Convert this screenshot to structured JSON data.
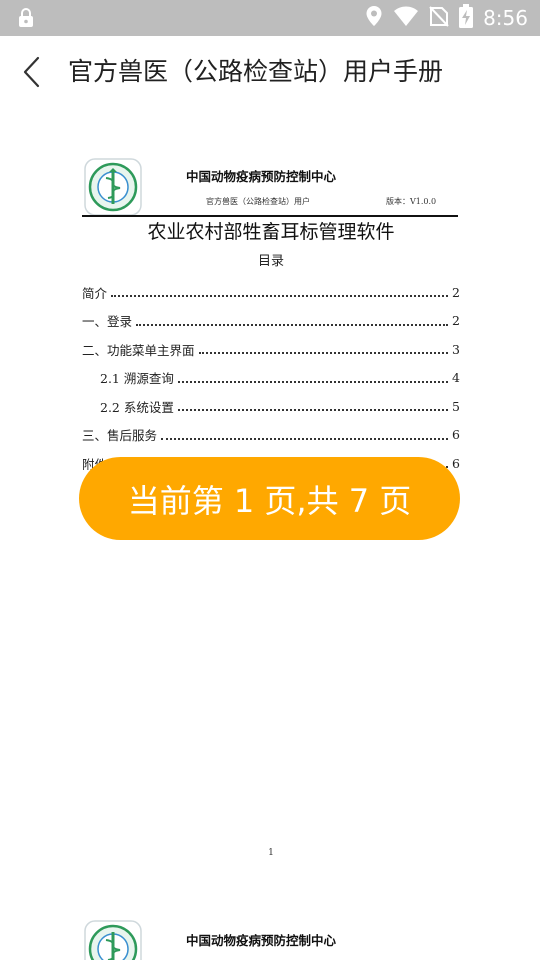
{
  "status_bar": {
    "time": "8:56",
    "icons": [
      "lock-icon",
      "location-icon",
      "wifi-icon",
      "no-sim-icon",
      "battery-charging-icon"
    ]
  },
  "app_bar": {
    "back_icon": "chevron-left-icon",
    "title": "官方兽医（公路检查站）用户手册"
  },
  "document": {
    "org_name": "中国动物疫病预防控制中心",
    "header_left": "官方兽医（公路检查站）用户",
    "header_right": "版本：V1.0.0",
    "title": "农业农村部牲畜耳标管理软件",
    "toc_heading": "目录",
    "toc": [
      {
        "label": "简介",
        "page": "2",
        "indent": false
      },
      {
        "label": "一、登录",
        "page": "2",
        "indent": false
      },
      {
        "label": "二、功能菜单主界面",
        "page": "3",
        "indent": false
      },
      {
        "label": "2.1 溯源查询",
        "page": "4",
        "indent": true
      },
      {
        "label": "2.2 系统设置",
        "page": "5",
        "indent": true
      },
      {
        "label": "三、售后服务",
        "page": "6",
        "indent": false
      },
      {
        "label": "附件",
        "page": "6",
        "indent": false
      }
    ],
    "page_number": "1"
  },
  "document_page_2": {
    "org_name": "中国动物疫病预防控制中心"
  },
  "toast": {
    "text": "当前第 1 页,共 7 页"
  },
  "colors": {
    "status_bar": "#bdbdbd",
    "toast": "#ffa800",
    "logo_green": "#2e9a5a"
  }
}
